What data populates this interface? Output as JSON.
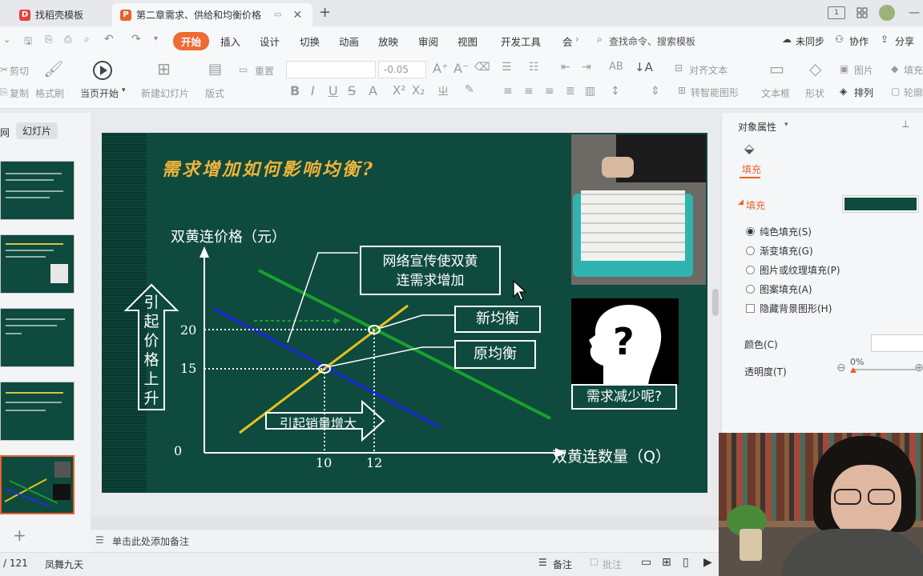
{
  "tabs": [
    {
      "label": "找稻壳模板",
      "icon": "D",
      "color": "#e8413b"
    },
    {
      "label": "第二章需求、供给和均衡价格",
      "icon": "P",
      "color": "#e8622c"
    }
  ],
  "window": {
    "new_tab": "+",
    "ctrl_a": "1",
    "ctrl_min": "—"
  },
  "menu": {
    "items": [
      "开始",
      "插入",
      "设计",
      "切换",
      "动画",
      "放映",
      "审阅",
      "视图",
      "开发工具",
      "会"
    ],
    "search": "查找命令、搜索模板",
    "sync": "未同步",
    "collab": "协作",
    "share": "分享"
  },
  "ribbon": {
    "cut": "剪切",
    "copy": "复制",
    "format_painter": "格式刷",
    "play_current": "当页开始",
    "new_slide": "新建幻灯片",
    "layout": "版式",
    "reset": "重置",
    "font_size": "-0.05",
    "align_text": "对齐文本",
    "smart_shape": "转智能图形",
    "textbox": "文本框",
    "shape": "形状",
    "picture": "图片",
    "arrange": "排列",
    "fill": "填充",
    "outline": "轮廓"
  },
  "left_pane": {
    "tab_outline": "网",
    "tab_slides": "幻灯片",
    "add": "+"
  },
  "slide": {
    "title": "需求增加如何影响均衡?",
    "y_axis_label": "双黄连价格（元）",
    "x_axis_label": "双黄连数量（Q）",
    "price_up": [
      "引",
      "起",
      "价",
      "格",
      "上",
      "升"
    ],
    "callout_demand": [
      "网络宣传使双黄",
      "连需求增加"
    ],
    "new_eq": "新均衡",
    "old_eq": "原均衡",
    "sales_up": "引起销量增大",
    "question": "需求减少呢?",
    "tick_0": "0",
    "tick_15": "15",
    "tick_20": "20",
    "tick_10": "10",
    "tick_12": "12",
    "qmark": "?"
  },
  "notes": {
    "placeholder": "单击此处添加备注"
  },
  "right_pane": {
    "header": "对象属性",
    "tab_fill": "填充",
    "section_fill": "填充",
    "fill_color": "#0f4a3f",
    "options": [
      {
        "label": "纯色填充(S)",
        "checked": true
      },
      {
        "label": "渐变填充(G)",
        "checked": false
      },
      {
        "label": "图片或纹理填充(P)",
        "checked": false
      },
      {
        "label": "图案填充(A)",
        "checked": false
      }
    ],
    "hide_bg": "隐藏背景图形(H)",
    "color_label": "颜色(C)",
    "transparency_label": "透明度(T)",
    "transparency_value": "0%"
  },
  "status": {
    "page": "/ 121",
    "theme": "凤舞九天",
    "notes_btn": "备注",
    "comment_btn": "批注"
  }
}
